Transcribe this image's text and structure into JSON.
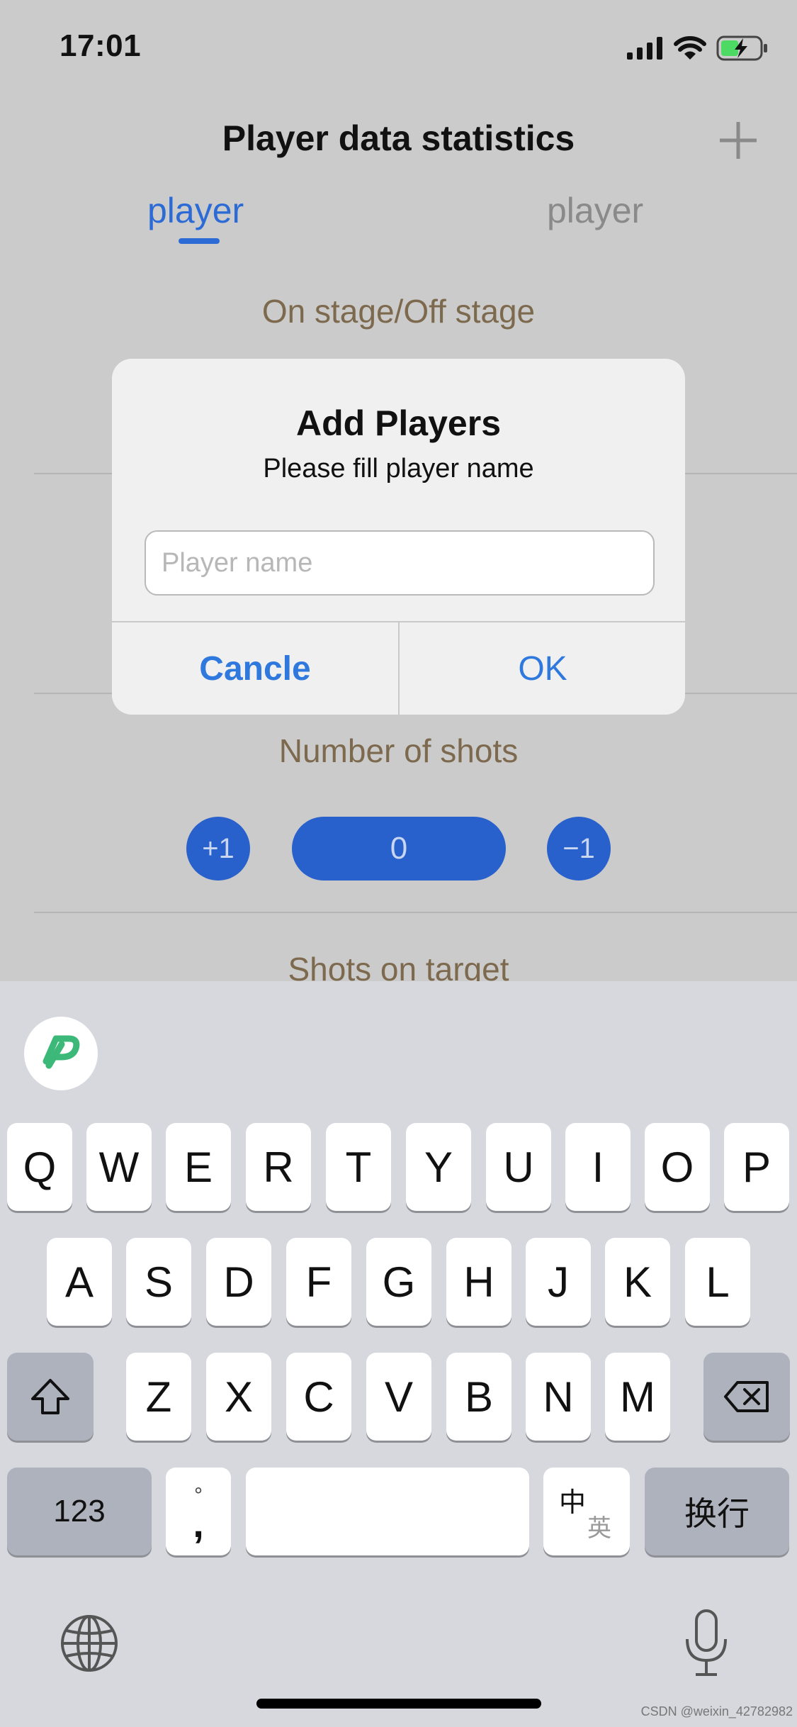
{
  "status_bar": {
    "time": "17:01",
    "icons": [
      "signal-icon",
      "wifi-icon",
      "battery-charging-icon"
    ],
    "battery_color": "#4cd964"
  },
  "nav": {
    "title": "Player data statistics",
    "add_icon": "plus-icon"
  },
  "tabs": [
    {
      "label": "player",
      "active": true
    },
    {
      "label": "player",
      "active": false
    }
  ],
  "sections": {
    "on_off_stage": "On stage/Off stage",
    "number_of_shots": "Number of shots",
    "shots_on_target": "Shots on target"
  },
  "shots_counter": {
    "plus_label": "+1",
    "value": "0",
    "minus_label": "−1"
  },
  "alert": {
    "title": "Add Players",
    "message": "Please fill player name",
    "input_value": "",
    "input_placeholder": "Player name",
    "cancel_label": "Cancle",
    "ok_label": "OK"
  },
  "keyboard": {
    "row1": [
      "Q",
      "W",
      "E",
      "R",
      "T",
      "Y",
      "U",
      "I",
      "O",
      "P"
    ],
    "row2": [
      "A",
      "S",
      "D",
      "F",
      "G",
      "H",
      "J",
      "K",
      "L"
    ],
    "row3": [
      "Z",
      "X",
      "C",
      "V",
      "B",
      "N",
      "M"
    ],
    "numbers_label": "123",
    "punct_top": "°",
    "punct_bottom": ",",
    "lang_top": "中",
    "lang_bottom": "英",
    "return_label": "换行",
    "app_badge_icon": "p-logo-icon",
    "globe_icon": "globe-icon",
    "mic_icon": "microphone-icon",
    "shift_icon": "shift-icon",
    "delete_icon": "delete-icon"
  },
  "watermark": "CSDN @weixin_42782982",
  "colors": {
    "accent": "#2c6bd6",
    "section_text": "#7d6a4e",
    "alert_button": "#2f78de"
  }
}
